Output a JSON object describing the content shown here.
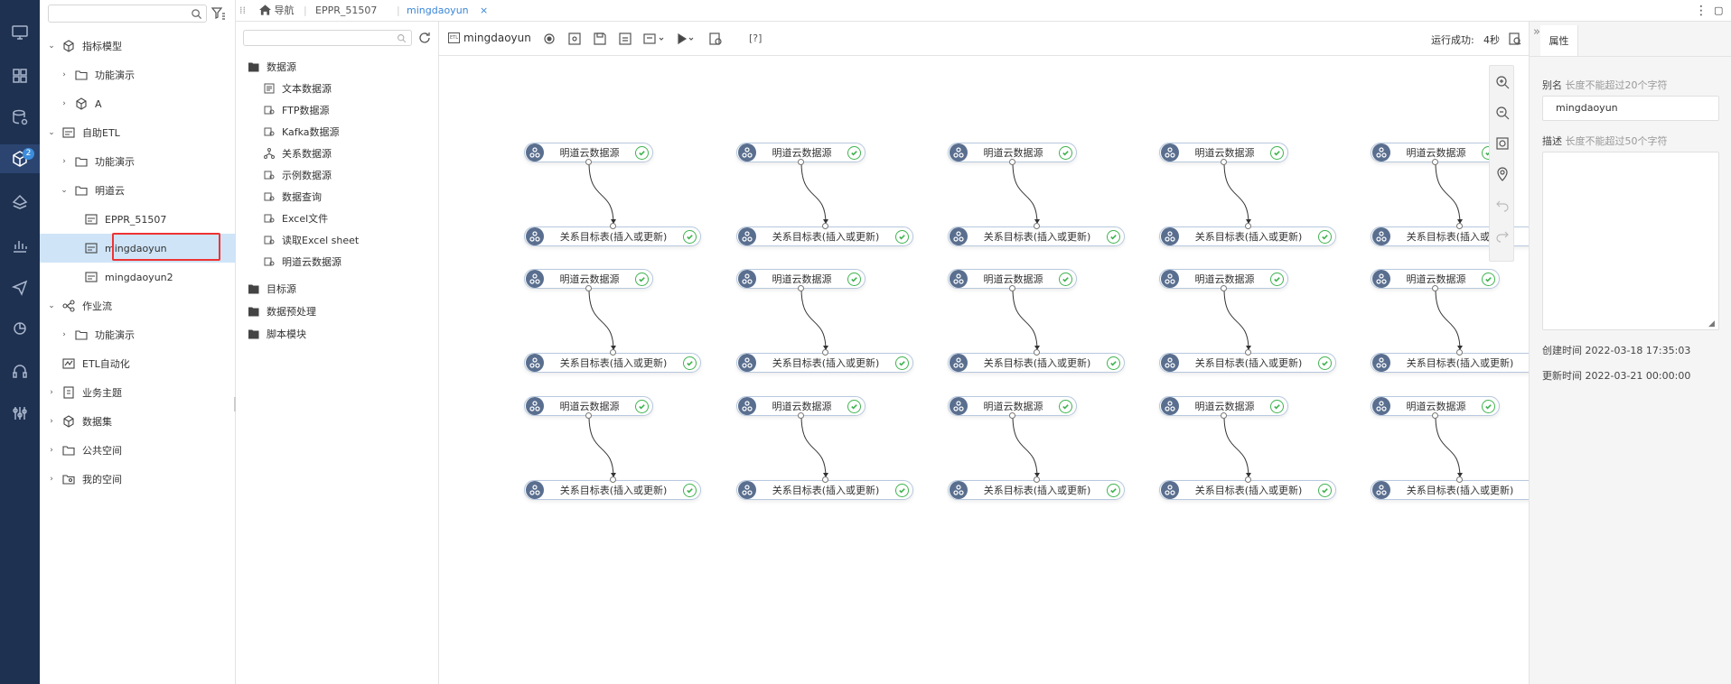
{
  "rail": {
    "badge": "2"
  },
  "tree": {
    "search_placeholder": "",
    "items": [
      {
        "label": "指标模型",
        "caret": "v"
      },
      {
        "label": "功能演示",
        "caret": ">"
      },
      {
        "label": "A",
        "caret": ">"
      },
      {
        "label": "自助ETL",
        "caret": "v"
      },
      {
        "label": "功能演示",
        "caret": ">"
      },
      {
        "label": "明道云",
        "caret": "v"
      },
      {
        "label": "EPPR_51507",
        "caret": ""
      },
      {
        "label": "mingdaoyun",
        "caret": ""
      },
      {
        "label": "mingdaoyun2",
        "caret": ""
      },
      {
        "label": "作业流",
        "caret": "v"
      },
      {
        "label": "功能演示",
        "caret": ">"
      },
      {
        "label": "ETL自动化",
        "caret": ""
      },
      {
        "label": "业务主题",
        "caret": ">"
      },
      {
        "label": "数据集",
        "caret": ">"
      },
      {
        "label": "公共空间",
        "caret": ">"
      },
      {
        "label": "我的空间",
        "caret": ">"
      }
    ]
  },
  "tabs": {
    "nav_label": "导航",
    "tab1": "EPPR_51507",
    "tab2": "mingdaoyun",
    "close": "×"
  },
  "components": {
    "search_placeholder": "",
    "datasource": "数据源",
    "sources": [
      "文本数据源",
      "FTP数据源",
      "Kafka数据源",
      "关系数据源",
      "示例数据源",
      "数据查询",
      "Excel文件",
      "读取Excel sheet",
      "明道云数据源"
    ],
    "target": "目标源",
    "preprocess": "数据预处理",
    "script": "脚本模块"
  },
  "toolbar": {
    "title": "mingdaoyun",
    "help": "[?]",
    "status": "运行成功:",
    "duration": "4秒"
  },
  "canvas": {
    "source_label": "明道云数据源",
    "target_label": "关系目标表(插入或更新)"
  },
  "props": {
    "tab": "属性",
    "alias_label": "别名",
    "alias_hint": "长度不能超过20个字符",
    "alias_value": "mingdaoyun",
    "desc_label": "描述",
    "desc_hint": "长度不能超过50个字符",
    "desc_value": "",
    "created_label": "创建时间",
    "created_value": "2022-03-18 17:35:03",
    "updated_label": "更新时间",
    "updated_value": "2022-03-21 00:00:00"
  }
}
